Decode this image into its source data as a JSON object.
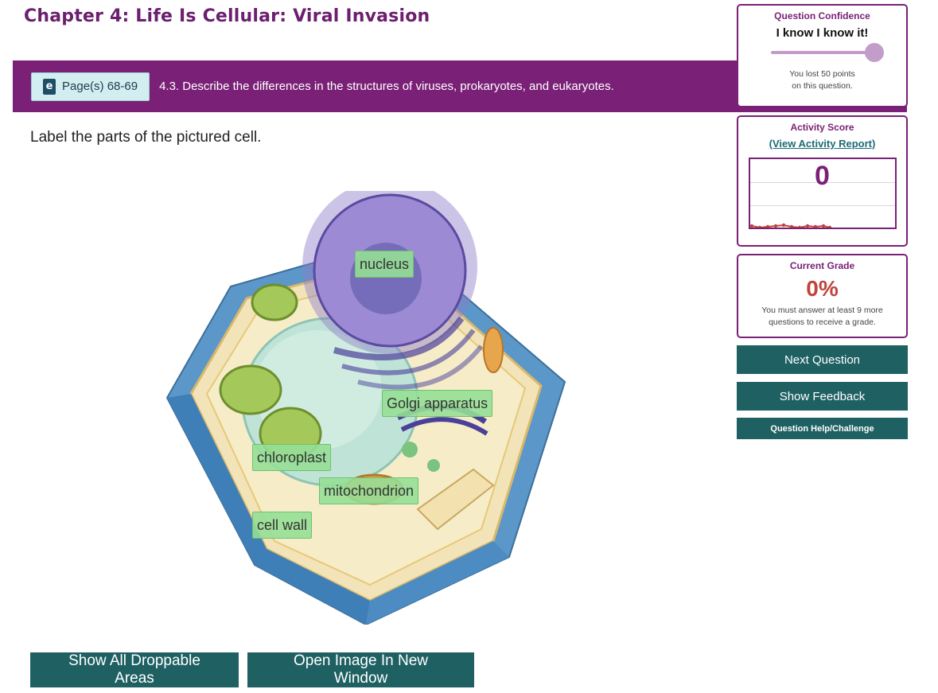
{
  "header": {
    "chapter_title": "Chapter 4: Life Is Cellular: Viral Invasion"
  },
  "objective": {
    "page_label": "Page(s) 68-69",
    "text": "4.3. Describe the differences in the structures of viruses, prokaryotes, and eukaryotes."
  },
  "question": {
    "prompt": "Label the parts of the pictured cell."
  },
  "labels": {
    "nucleus": "nucleus",
    "golgi": "Golgi apparatus",
    "chloroplast": "chloroplast",
    "mitochondrion": "mitochondrion",
    "cell_wall": "cell wall"
  },
  "buttons": {
    "show_droppable": "Show All Droppable Areas",
    "open_image": "Open Image In New Window",
    "next_question": "Next Question",
    "show_feedback": "Show Feedback",
    "question_help": "Question Help/Challenge"
  },
  "confidence": {
    "title": "Question Confidence",
    "value": "I know I know it!",
    "slider_fraction": 1.0,
    "note_line1": "You lost 50 points",
    "note_line2": "on this question."
  },
  "activity": {
    "title": "Activity Score",
    "report_link": "(View Activity Report)",
    "score": "0"
  },
  "grade": {
    "title": "Current Grade",
    "value": "0%",
    "note_line1": "You must answer at least 9 more",
    "note_line2": "questions to receive a grade."
  },
  "colors": {
    "brand_purple": "#7a2177",
    "teal_button": "#1f6063",
    "grade_red": "#c0443a",
    "label_green": "#96de96"
  }
}
